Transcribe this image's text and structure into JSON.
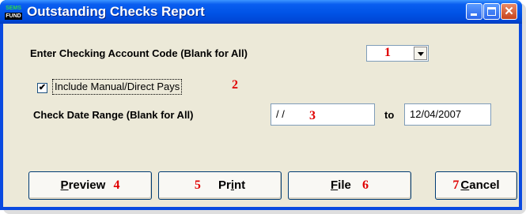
{
  "window": {
    "title": "Outstanding Checks Report",
    "app_icon_text_top": "SEMS",
    "app_icon_text_bottom": "FUND",
    "controls": [
      "minimize",
      "maximize",
      "close"
    ]
  },
  "form": {
    "account_code_label": "Enter Checking Account Code (Blank for All)",
    "account_code_marker": "1",
    "account_code_value": "",
    "include_manual_label": "Include Manual/Direct Pays",
    "include_manual_checked": true,
    "include_manual_marker": "2",
    "date_range_label": "Check Date Range (Blank for All)",
    "date_from_value": " / /",
    "date_from_marker": "3",
    "to_label": "to",
    "date_to_value": "12/04/2007"
  },
  "buttons": {
    "preview": {
      "mnemonic": "P",
      "rest": "review",
      "marker": "4"
    },
    "print": {
      "pre": "Pr",
      "mnemonic": "i",
      "rest": "nt",
      "marker": "5"
    },
    "file": {
      "mnemonic": "F",
      "rest": "ile",
      "marker": "6"
    },
    "cancel": {
      "mnemonic": "C",
      "rest": "ancel",
      "marker": "7"
    }
  },
  "colors": {
    "titlebar": "#0053e6",
    "marker": "#e00000",
    "client": "#ece9d8"
  }
}
